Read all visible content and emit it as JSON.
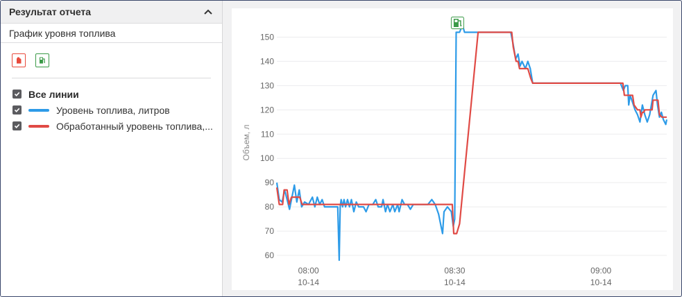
{
  "left_panel": {
    "title": "Результат отчета",
    "subtitle": "График уровня топлива",
    "icons": [
      {
        "name": "fuel-drain-icon",
        "color": "#e84a3c"
      },
      {
        "name": "fuel-station-icon",
        "color": "#3b9a48"
      }
    ],
    "legend": {
      "all_lines": "Все линии",
      "items": [
        {
          "label": "Уровень топлива, литров",
          "color": "#2d9be8"
        },
        {
          "label": "Обработанный уровень топлива,...",
          "color": "#e04a45"
        }
      ]
    }
  },
  "chart_data": {
    "type": "line",
    "xlabel": "",
    "ylabel": "Объем, л",
    "ylim": [
      56,
      157
    ],
    "yticks": [
      60,
      70,
      80,
      90,
      100,
      110,
      120,
      130,
      140,
      150
    ],
    "x_unit": "minutes",
    "xlim": [
      473.5,
      553.5
    ],
    "xticks": [
      {
        "x": 480,
        "time": "08:00",
        "date": "10-14"
      },
      {
        "x": 510,
        "time": "08:30",
        "date": "10-14"
      },
      {
        "x": 540,
        "time": "09:00",
        "date": "10-14"
      }
    ],
    "grid": true,
    "annotations": [
      {
        "type": "refuel-marker-icon",
        "x": 510.5,
        "color": "#3b9a48"
      }
    ],
    "series": [
      {
        "name": "Уровень топлива, литров",
        "color": "#2d9be8",
        "points": [
          [
            473.5,
            90
          ],
          [
            474.0,
            83
          ],
          [
            474.6,
            82
          ],
          [
            475.1,
            87
          ],
          [
            475.6,
            83
          ],
          [
            476.1,
            79
          ],
          [
            476.6,
            84
          ],
          [
            477.1,
            89
          ],
          [
            477.6,
            82
          ],
          [
            478.1,
            87
          ],
          [
            478.6,
            80
          ],
          [
            479.2,
            82
          ],
          [
            480.0,
            81
          ],
          [
            480.8,
            84
          ],
          [
            481.3,
            80
          ],
          [
            481.8,
            84
          ],
          [
            482.3,
            81
          ],
          [
            482.8,
            83
          ],
          [
            483.3,
            80
          ],
          [
            486.0,
            80
          ],
          [
            486.3,
            58
          ],
          [
            486.5,
            80
          ],
          [
            486.7,
            83
          ],
          [
            487.0,
            80
          ],
          [
            487.3,
            83
          ],
          [
            487.6,
            80
          ],
          [
            488.0,
            83
          ],
          [
            488.4,
            80
          ],
          [
            488.8,
            83
          ],
          [
            489.3,
            78
          ],
          [
            489.8,
            82
          ],
          [
            490.3,
            80
          ],
          [
            491.3,
            80
          ],
          [
            491.8,
            78
          ],
          [
            492.4,
            81
          ],
          [
            493.2,
            81
          ],
          [
            493.8,
            83
          ],
          [
            494.3,
            80
          ],
          [
            495.0,
            80
          ],
          [
            495.3,
            83
          ],
          [
            495.8,
            78
          ],
          [
            496.2,
            81
          ],
          [
            496.7,
            78
          ],
          [
            497.3,
            81
          ],
          [
            497.7,
            78
          ],
          [
            498.3,
            81
          ],
          [
            498.6,
            78
          ],
          [
            499.2,
            83
          ],
          [
            499.7,
            81
          ],
          [
            500.3,
            81
          ],
          [
            500.9,
            79
          ],
          [
            501.5,
            81
          ],
          [
            502.0,
            81
          ],
          [
            502.5,
            81
          ],
          [
            503.3,
            81
          ],
          [
            504.5,
            81
          ],
          [
            505.3,
            83
          ],
          [
            506.0,
            81
          ],
          [
            506.7,
            77
          ],
          [
            507.2,
            72
          ],
          [
            507.5,
            69
          ],
          [
            507.8,
            78
          ],
          [
            508.5,
            80
          ],
          [
            509.3,
            78
          ],
          [
            509.7,
            72
          ],
          [
            510.0,
            75
          ],
          [
            510.3,
            152
          ],
          [
            511.0,
            152
          ],
          [
            511.6,
            155
          ],
          [
            512.0,
            152
          ],
          [
            520.0,
            152
          ],
          [
            521.5,
            152
          ],
          [
            522.0,
            147
          ],
          [
            522.5,
            141
          ],
          [
            523.0,
            143
          ],
          [
            523.4,
            138
          ],
          [
            523.8,
            140
          ],
          [
            524.5,
            137
          ],
          [
            525.0,
            140
          ],
          [
            525.5,
            137
          ],
          [
            526.0,
            131
          ],
          [
            544.0,
            131
          ],
          [
            544.6,
            128
          ],
          [
            545.0,
            130
          ],
          [
            545.5,
            130
          ],
          [
            545.7,
            122
          ],
          [
            546.0,
            126
          ],
          [
            546.5,
            123
          ],
          [
            547.0,
            120
          ],
          [
            547.5,
            118
          ],
          [
            548.0,
            115
          ],
          [
            548.5,
            122
          ],
          [
            549.0,
            118
          ],
          [
            549.5,
            115
          ],
          [
            550.0,
            118
          ],
          [
            550.7,
            126
          ],
          [
            551.3,
            128
          ],
          [
            551.6,
            122
          ],
          [
            552.0,
            117
          ],
          [
            552.4,
            119
          ],
          [
            552.8,
            116
          ],
          [
            553.3,
            114
          ],
          [
            553.5,
            116
          ]
        ]
      },
      {
        "name": "Обработанный уровень топлива,...",
        "color": "#e04a45",
        "points": [
          [
            473.5,
            88
          ],
          [
            474.0,
            81
          ],
          [
            474.7,
            81
          ],
          [
            475.0,
            87
          ],
          [
            475.6,
            87
          ],
          [
            476.0,
            81
          ],
          [
            476.5,
            84
          ],
          [
            477.0,
            84
          ],
          [
            478.2,
            84
          ],
          [
            478.7,
            81
          ],
          [
            480.5,
            81
          ],
          [
            484.0,
            81
          ],
          [
            488.0,
            81
          ],
          [
            492.0,
            81
          ],
          [
            496.0,
            81
          ],
          [
            500.0,
            81
          ],
          [
            504.0,
            81
          ],
          [
            508.0,
            81
          ],
          [
            509.5,
            81
          ],
          [
            509.8,
            69
          ],
          [
            510.4,
            69
          ],
          [
            511.0,
            73
          ],
          [
            514.8,
            152
          ],
          [
            521.7,
            152
          ],
          [
            522.0,
            146
          ],
          [
            522.6,
            140
          ],
          [
            523.0,
            140
          ],
          [
            523.3,
            137
          ],
          [
            525.0,
            137
          ],
          [
            525.6,
            133
          ],
          [
            526.0,
            131
          ],
          [
            531.0,
            131
          ],
          [
            537.0,
            131
          ],
          [
            544.5,
            131
          ],
          [
            544.8,
            126
          ],
          [
            545.5,
            126
          ],
          [
            546.5,
            126
          ],
          [
            546.8,
            122
          ],
          [
            547.5,
            120
          ],
          [
            548.0,
            120
          ],
          [
            548.2,
            117
          ],
          [
            548.5,
            119
          ],
          [
            548.8,
            119
          ],
          [
            549.0,
            120
          ],
          [
            550.5,
            120
          ],
          [
            550.7,
            124
          ],
          [
            551.7,
            124
          ],
          [
            552.0,
            118
          ],
          [
            552.5,
            117
          ],
          [
            553.5,
            117
          ]
        ]
      }
    ]
  }
}
